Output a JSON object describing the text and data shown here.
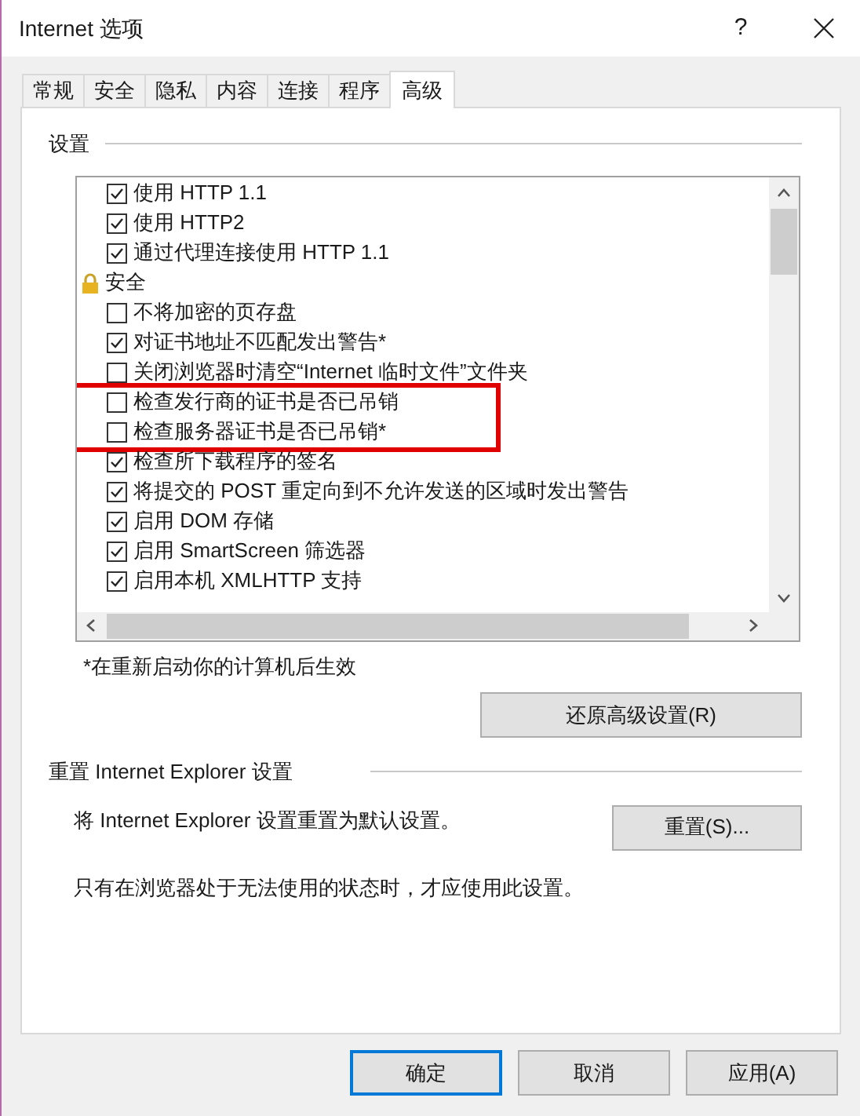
{
  "window": {
    "title": "Internet 选项",
    "help": "?"
  },
  "tabs": [
    {
      "label": "常规",
      "selected": false
    },
    {
      "label": "安全",
      "selected": false
    },
    {
      "label": "隐私",
      "selected": false
    },
    {
      "label": "内容",
      "selected": false
    },
    {
      "label": "连接",
      "selected": false
    },
    {
      "label": "程序",
      "selected": false
    },
    {
      "label": "高级",
      "selected": true
    }
  ],
  "settings": {
    "heading": "设置",
    "items": [
      {
        "kind": "checkbox",
        "label": "使用 HTTP 1.1",
        "checked": true,
        "highlighted": false
      },
      {
        "kind": "checkbox",
        "label": "使用 HTTP2",
        "checked": true,
        "highlighted": false
      },
      {
        "kind": "checkbox",
        "label": "通过代理连接使用 HTTP 1.1",
        "checked": true,
        "highlighted": false
      },
      {
        "kind": "group",
        "label": "安全"
      },
      {
        "kind": "checkbox",
        "label": "不将加密的页存盘",
        "checked": false,
        "highlighted": false
      },
      {
        "kind": "checkbox",
        "label": "对证书地址不匹配发出警告*",
        "checked": true,
        "highlighted": false
      },
      {
        "kind": "checkbox",
        "label": "关闭浏览器时清空“Internet 临时文件”文件夹",
        "checked": false,
        "highlighted": false
      },
      {
        "kind": "checkbox",
        "label": "检查发行商的证书是否已吊销",
        "checked": false,
        "highlighted": true
      },
      {
        "kind": "checkbox",
        "label": "检查服务器证书是否已吊销*",
        "checked": false,
        "highlighted": true
      },
      {
        "kind": "checkbox",
        "label": "检查所下载程序的签名",
        "checked": true,
        "highlighted": false
      },
      {
        "kind": "checkbox",
        "label": "将提交的 POST 重定向到不允许发送的区域时发出警告",
        "checked": true,
        "highlighted": false
      },
      {
        "kind": "checkbox",
        "label": "启用 DOM 存储",
        "checked": true,
        "highlighted": false
      },
      {
        "kind": "checkbox",
        "label": "启用 SmartScreen 筛选器",
        "checked": true,
        "highlighted": false
      },
      {
        "kind": "checkbox",
        "label": "启用本机 XMLHTTP 支持",
        "checked": true,
        "highlighted": false
      }
    ],
    "note": "*在重新启动你的计算机后生效",
    "restore_button": "还原高级设置(R)"
  },
  "reset": {
    "heading": "重置 Internet Explorer 设置",
    "description": "将 Internet Explorer 设置重置为默认设置。",
    "button": "重置(S)...",
    "note": "只有在浏览器处于无法使用的状态时，才应使用此设置。"
  },
  "buttons": [
    {
      "label": "确定",
      "selected": true
    },
    {
      "label": "取消",
      "selected": false
    },
    {
      "label": "应用(A)",
      "selected": false
    }
  ]
}
